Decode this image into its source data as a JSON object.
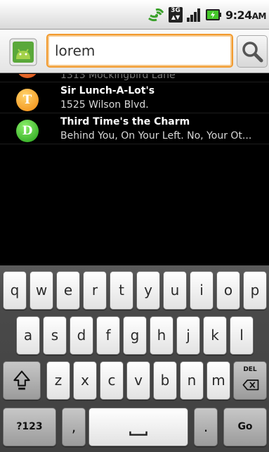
{
  "status_bar": {
    "time": "9:24",
    "time_suffix": "AM",
    "icons": [
      "sync-icon",
      "3g-icon",
      "signal-icon",
      "battery-icon"
    ],
    "network_label": "3G"
  },
  "search": {
    "value": "lorem",
    "app_icon": "android-app-icon",
    "button_icon": "search-icon"
  },
  "results": [
    {
      "letter": "",
      "title": "",
      "subtitle": "1313 Mockingbird Lane",
      "color": "#e05a1a",
      "partial": true
    },
    {
      "letter": "T",
      "title": "Sir Lunch-A-Lot's",
      "subtitle": "1525 Wilson Blvd.",
      "color": "#f5a01a"
    },
    {
      "letter": "D",
      "title": "Third Time's the Charm",
      "subtitle": "Behind You, On Your Left. No, Your Ot...",
      "color": "#3db82a"
    }
  ],
  "keyboard": {
    "row1": [
      "q",
      "w",
      "e",
      "r",
      "t",
      "y",
      "u",
      "i",
      "o",
      "p"
    ],
    "row2": [
      "a",
      "s",
      "d",
      "f",
      "g",
      "h",
      "j",
      "k",
      "l"
    ],
    "row3": [
      "z",
      "x",
      "c",
      "v",
      "b",
      "n",
      "m"
    ],
    "shift_icon": "shift-icon",
    "del_label": "DEL",
    "del_icon": "backspace-icon",
    "symbols_label": "?123",
    "comma_label": ",",
    "space_icon": "space-icon",
    "period_label": ".",
    "go_label": "Go"
  }
}
